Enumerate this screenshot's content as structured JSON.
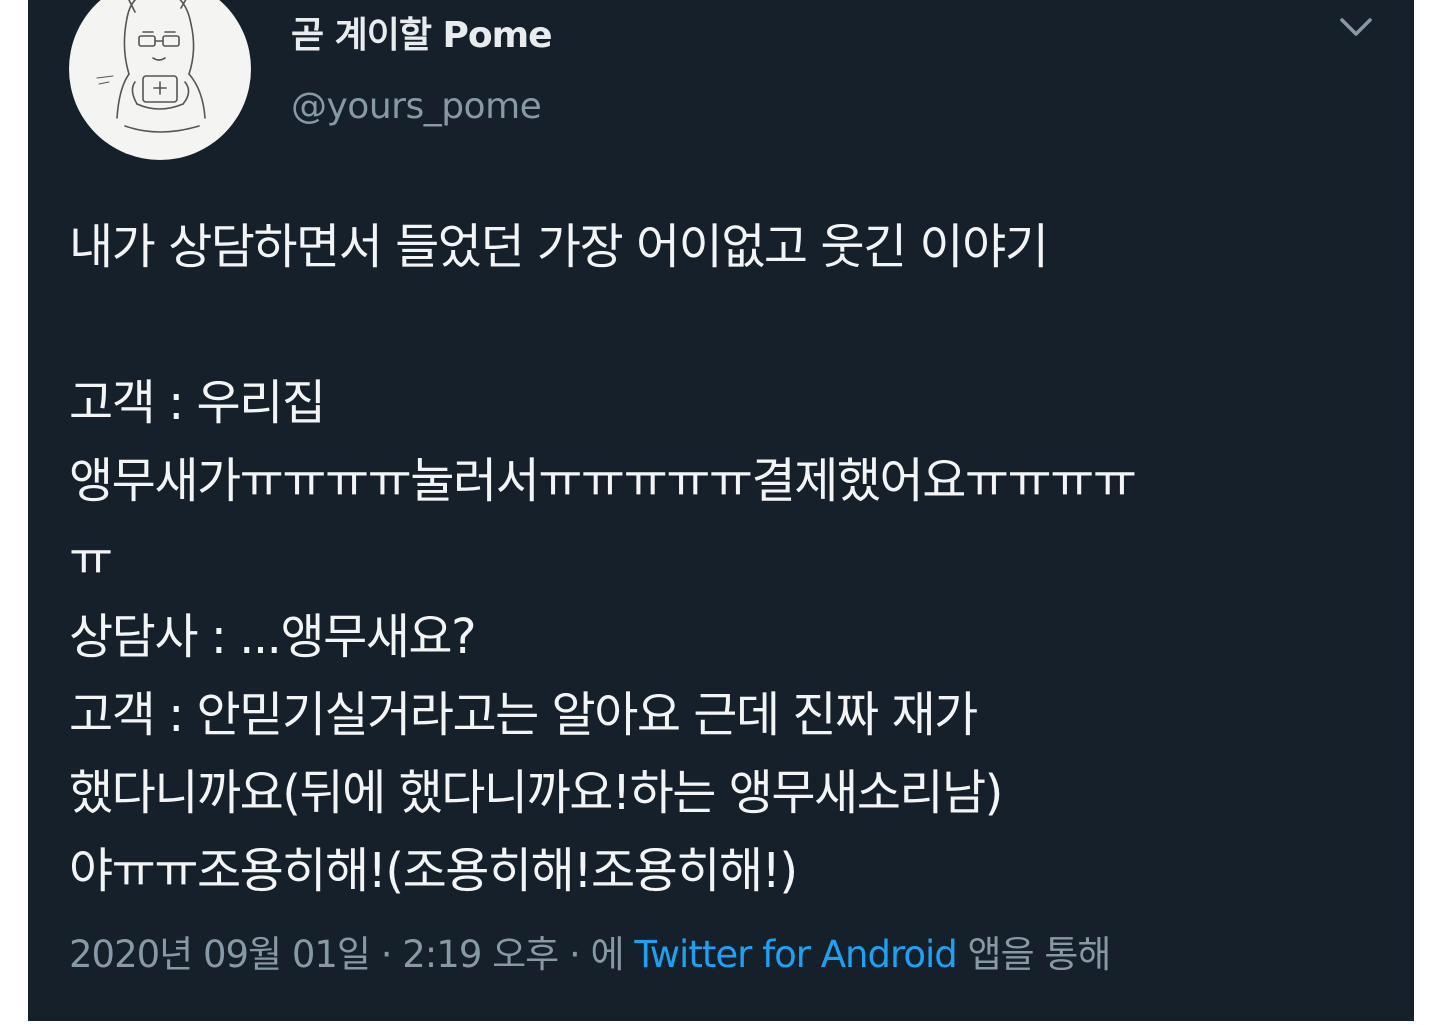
{
  "user": {
    "display_name": "곧 계이할 Pome",
    "handle": "@yours_pome",
    "avatar_icon": "avatar-sketch",
    "menu_icon": "chevron-down-icon"
  },
  "tweet": {
    "lines": [
      "내가 상담하면서 들었던 가장 어이없고 웃긴 이야기",
      "",
      "고객 : 우리집",
      "앵무새가ㅠㅠㅠㅠ눌러서ㅠㅠㅠㅠㅠ결제했어요ㅠㅠㅠㅠ",
      "ㅠ",
      "상담사 : ...앵무새요?",
      "고객 : 안믿기실거라고는 알아요 근데 진짜 재가",
      "했다니까요(뒤에 했다니까요!하는 앵무새소리남)",
      "야ㅠㅠ조용히해!(조용히해!조용히해!)"
    ]
  },
  "meta": {
    "date": "2020년 09월 01일",
    "separator": " · ",
    "time": "2:19 오후",
    "via_prefix": "에 ",
    "source": "Twitter for Android",
    "via_suffix": " 앱을 통해"
  },
  "colors": {
    "background": "#15202b",
    "text": "#f3f4f5",
    "secondary": "#8899a6",
    "link": "#1da1f2"
  }
}
